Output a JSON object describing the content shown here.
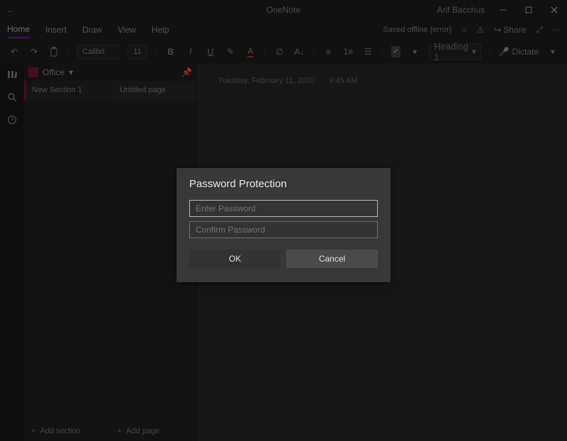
{
  "titlebar": {
    "app_name": "OneNote",
    "user_name": "Arif Bacchus"
  },
  "tabs": {
    "items": [
      "Home",
      "Insert",
      "Draw",
      "View",
      "Help"
    ],
    "active_index": 0,
    "status_text": "Saved offline (error)",
    "share_label": "Share"
  },
  "ribbon": {
    "font_name": "Calibri",
    "font_size": "11",
    "style_picker": "Heading 1",
    "dictate_label": "Dictate"
  },
  "notebook": {
    "name": "Office",
    "sections": [
      {
        "name": "New Section 1"
      }
    ],
    "pages": [
      {
        "title": "Untitled page"
      }
    ],
    "add_section_label": "Add section",
    "add_page_label": "Add page"
  },
  "page": {
    "date": "Tuesday, February 11, 2020",
    "time": "9:45 AM"
  },
  "dialog": {
    "title": "Password Protection",
    "enter_placeholder": "Enter Password",
    "confirm_placeholder": "Confirm Password",
    "ok_label": "OK",
    "cancel_label": "Cancel"
  }
}
